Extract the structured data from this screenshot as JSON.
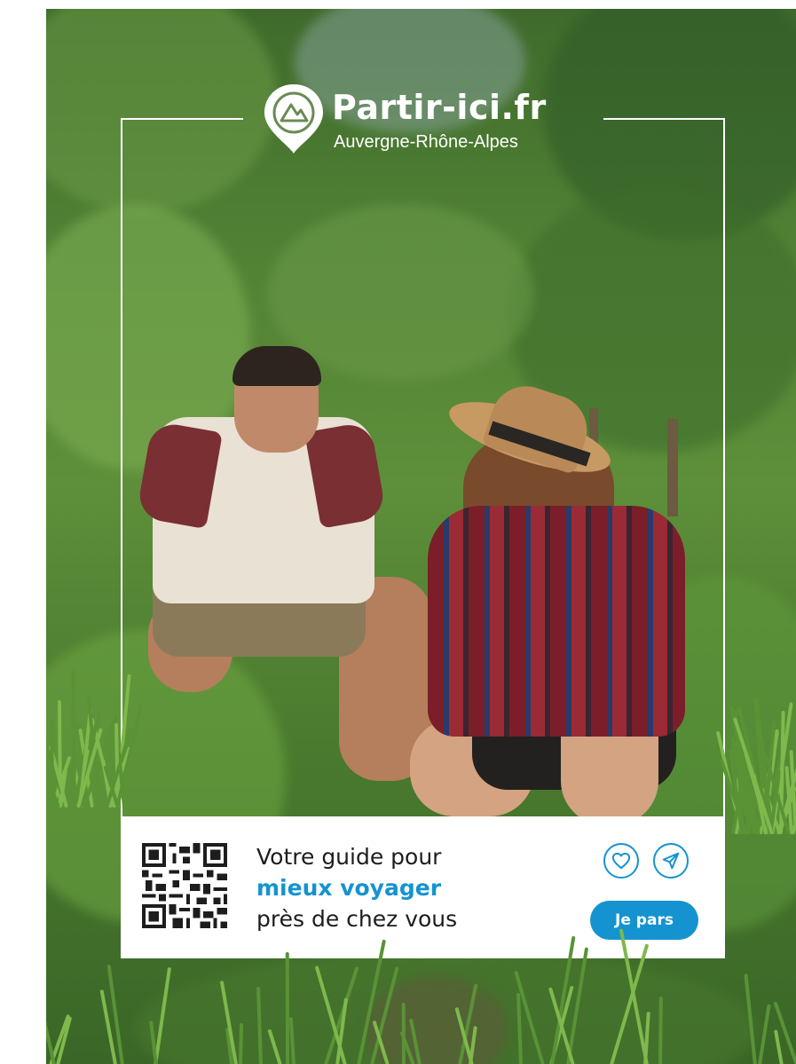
{
  "brand": {
    "title": "Partir-ici.fr",
    "subtitle": "Auvergne-Rhône-Alpes",
    "logo_icon": "map-pin-mountain-icon"
  },
  "card": {
    "line1": "Votre guide pour",
    "line2_accent": "mieux voyager",
    "line3": "près de chez vous",
    "cta_label": "Je pars",
    "favorite_icon": "heart-icon",
    "share_icon": "send-icon",
    "qr_icon": "qr-code-icon"
  },
  "colors": {
    "accent": "#1593d0",
    "card_bg": "#ffffff",
    "frame": "#ffffff"
  }
}
